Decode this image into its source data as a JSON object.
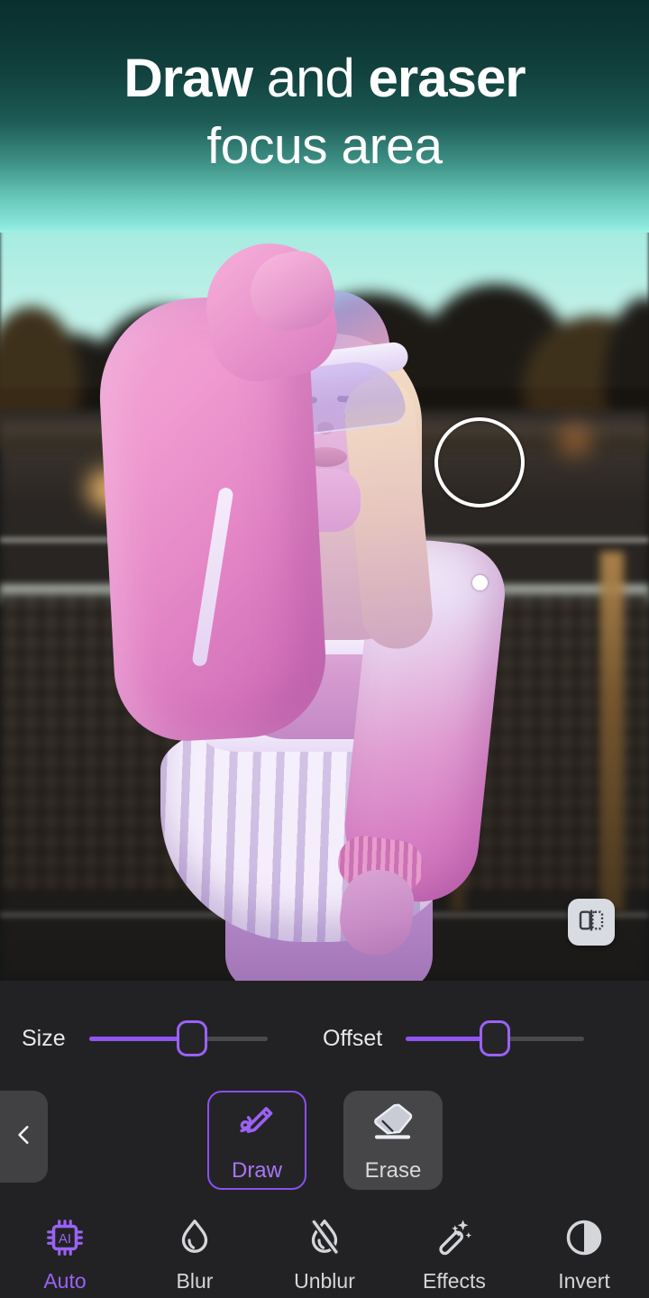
{
  "header": {
    "title_bold_1": "Draw",
    "title_regular_1": "and",
    "title_bold_2": "eraser",
    "title_line2": "focus area"
  },
  "canvas": {
    "brush_cursor_name": "brush-ring-cursor",
    "brush_dot_name": "brush-dot-cursor",
    "compare_button_icon": "compare-split-icon"
  },
  "controls": {
    "sliders": [
      {
        "label": "Size",
        "value_percent": 58,
        "name": "size-slider"
      },
      {
        "label": "Offset",
        "value_percent": 50,
        "name": "offset-slider"
      }
    ],
    "back_icon": "chevron-left-icon",
    "tools": [
      {
        "label": "Draw",
        "icon": "pencil-draw-icon",
        "selected": true
      },
      {
        "label": "Erase",
        "icon": "eraser-icon",
        "selected": false
      }
    ]
  },
  "navbar": {
    "items": [
      {
        "label": "Auto",
        "icon": "ai-chip-icon",
        "active": true
      },
      {
        "label": "Blur",
        "icon": "droplet-icon",
        "active": false
      },
      {
        "label": "Unblur",
        "icon": "droplet-slash-icon",
        "active": false
      },
      {
        "label": "Effects",
        "icon": "magic-wand-icon",
        "active": false
      },
      {
        "label": "Invert",
        "icon": "half-circle-icon",
        "active": false
      }
    ]
  },
  "colors": {
    "accent_purple": "#9055f2",
    "panel_background": "#222224",
    "tool_inactive": "#464648",
    "header_gradient_top": "#09302f",
    "header_gradient_bottom": "#9ff0e4"
  }
}
